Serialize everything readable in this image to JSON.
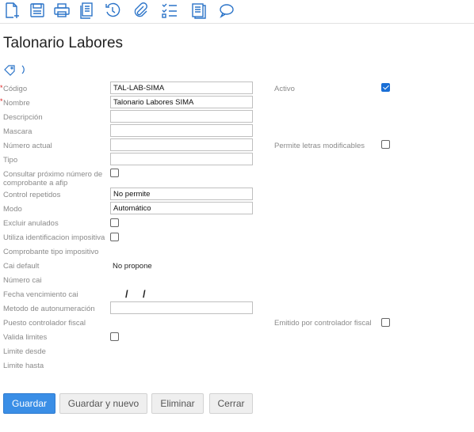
{
  "toolbar": {
    "icons": [
      "new-document-icon",
      "save-icon",
      "print-icon",
      "copy-icon",
      "history-icon",
      "attachment-icon",
      "checklist-icon",
      "notes-icon",
      "comment-icon"
    ]
  },
  "page": {
    "title": "Talonario Labores"
  },
  "form": {
    "codigo": {
      "label": "Código",
      "value": "TAL-LAB-SIMA",
      "required_mark": "*"
    },
    "nombre": {
      "label": "Nombre",
      "value": "Talonario Labores SIMA",
      "required_mark": "*"
    },
    "descripcion": {
      "label": "Descripción",
      "value": ""
    },
    "mascara": {
      "label": "Mascara",
      "value": ""
    },
    "numero_actual": {
      "label": "Número actual",
      "value": ""
    },
    "tipo": {
      "label": "Tipo",
      "value": ""
    },
    "consultar_afip": {
      "label_line1": "Consultar próximo número de",
      "label_line2": "comprobante a afip",
      "checked": false
    },
    "control_repetidos": {
      "label": "Control repetidos",
      "value": "No permite"
    },
    "modo": {
      "label": "Modo",
      "value": "Automático"
    },
    "excluir_anulados": {
      "label": "Excluir anulados",
      "checked": false
    },
    "utiliza_impositiva": {
      "label": "Utiliza identificacion impositiva",
      "checked": false
    },
    "comprobante_tipo_impositivo": {
      "label": "Comprobante tipo impositivo"
    },
    "cai_default": {
      "label": "Cai default",
      "value": "No propone"
    },
    "numero_cai": {
      "label": "Número cai"
    },
    "fecha_vencimiento_cai": {
      "label": "Fecha vencimiento cai",
      "sep1": "/",
      "sep2": "/"
    },
    "metodo_autonumeracion": {
      "label": "Metodo de autonumeración",
      "value": ""
    },
    "puesto_controlador_fiscal": {
      "label": "Puesto controlador fiscal"
    },
    "valida_limites": {
      "label": "Valida limites",
      "checked": false
    },
    "limite_desde": {
      "label": "Limite desde"
    },
    "limite_hasta": {
      "label": "Limite hasta"
    },
    "activo": {
      "label": "Activo",
      "checked": true
    },
    "permite_letras": {
      "label": "Permite letras modificables",
      "checked": false
    },
    "emitido_controlador": {
      "label": "Emitido por controlador fiscal",
      "checked": false
    }
  },
  "buttons": {
    "guardar": "Guardar",
    "guardar_nuevo": "Guardar y nuevo",
    "eliminar": "Eliminar",
    "cerrar": "Cerrar"
  },
  "colors": {
    "primary": "#3a8ee6",
    "icon": "#2a73c8",
    "required": "#dd2222"
  }
}
